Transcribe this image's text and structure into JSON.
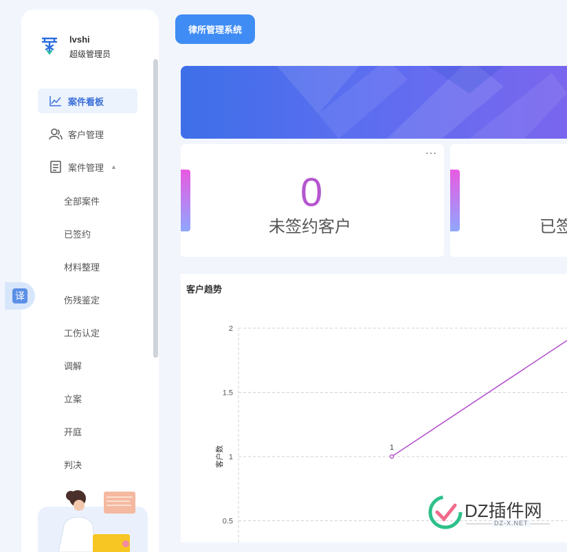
{
  "user": {
    "name": "lvshi",
    "role": "超级管理员"
  },
  "menu": {
    "dashboard": "案件看板",
    "clients": "客户管理",
    "cases": "案件管理",
    "case_items": [
      "全部案件",
      "已签约",
      "材料整理",
      "伤残鉴定",
      "工伤认定",
      "调解",
      "立案",
      "开庭",
      "判决"
    ]
  },
  "translate_label": "译",
  "header": {
    "system_title": "律所管理系统"
  },
  "stats": [
    {
      "value": "0",
      "label": "未签约客户"
    },
    {
      "label": "已签"
    }
  ],
  "stats_more": "···",
  "chart": {
    "title": "客户趋势"
  },
  "chart_data": {
    "type": "line",
    "title": "客户趋势",
    "ylabel": "客户数",
    "xlabel": "",
    "ylim": [
      0,
      2
    ],
    "yticks": [
      0.5,
      1,
      1.5,
      2
    ],
    "series": [
      {
        "points": [
          {
            "x": 0,
            "y": 1
          },
          {
            "x": 1,
            "y": 2
          }
        ],
        "data_labels": [
          "1",
          ""
        ]
      }
    ],
    "grid": true,
    "color": "#b556cf"
  },
  "watermark": {
    "brand": "DZ插件网",
    "url": "DZ-X.NET"
  },
  "colors": {
    "accent": "#3f8cf5",
    "active_menu": "#3a6fd8",
    "series": "#b556cf"
  }
}
